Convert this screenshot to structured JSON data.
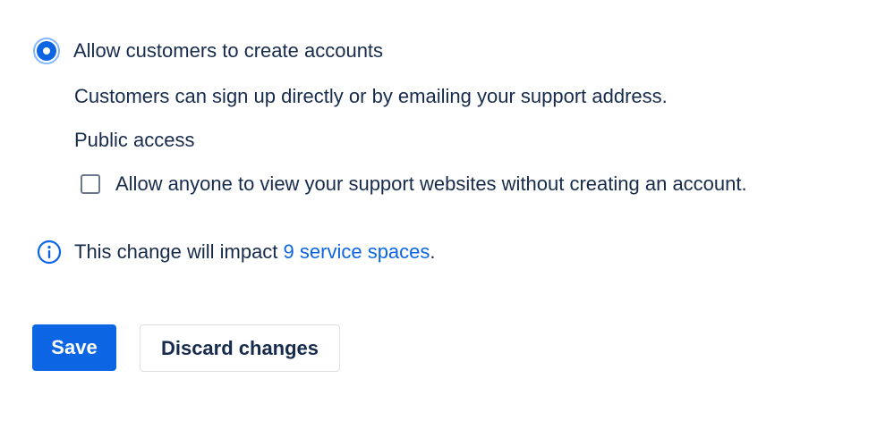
{
  "signup_option": {
    "label": "Allow customers to create accounts",
    "selected": true,
    "description": "Customers can sign up directly or by emailing your support address."
  },
  "public_access": {
    "heading": "Public access",
    "checkbox_label": "Allow anyone to view your support websites without creating an account.",
    "checked": false
  },
  "info": {
    "icon": "info-icon",
    "text_before": "This change will impact ",
    "link_text": "9 service spaces",
    "text_after": "."
  },
  "actions": {
    "save_label": "Save",
    "discard_label": "Discard changes"
  },
  "colors": {
    "primary": "#0c66e4",
    "text": "#172b4d",
    "radio_ring": "#85b8ff",
    "checkbox_border": "#6b778c",
    "button_border": "#dcdfe4"
  }
}
